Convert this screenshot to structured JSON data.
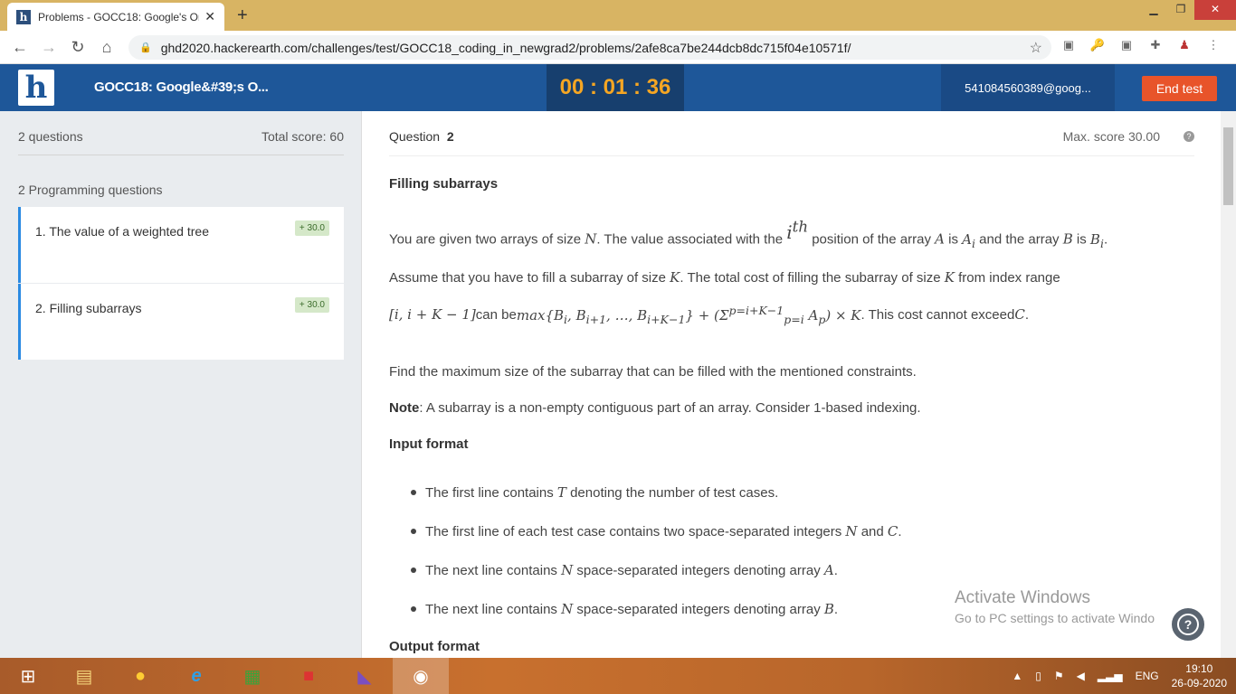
{
  "browser": {
    "tab_title": "Problems - GOCC18: Google's Or",
    "favicon_letter": "h",
    "url": "ghd2020.hackerearth.com/challenges/test/GOCC18_coding_in_newgrad2/problems/2afe8ca7be244dcb8dc715f04e10571f/"
  },
  "header": {
    "logo_letter": "h",
    "test_title": "GOCC18: Google&#39;s O...",
    "timer": "00 : 01 : 36",
    "user": "541084560389@goog...",
    "end_test": "End test"
  },
  "sidebar": {
    "questions_count": "2 questions",
    "total_score": "Total score: 60",
    "category": "2 Programming questions",
    "items": [
      {
        "label": "1.  The value of a weighted tree",
        "badge": "+ 30.0"
      },
      {
        "label": "2.  Filling subarrays",
        "badge": "+ 30.0"
      }
    ]
  },
  "question": {
    "label": "Question",
    "number": "2",
    "max_score": "Max. score 30.00",
    "title": "Filling subarrays",
    "p1_a": "You are given two arrays of size ",
    "p1_b": ". The value associated with the ",
    "p1_c": " position of the array ",
    "p1_d": " is ",
    "p1_e": " and the array ",
    "p1_f": " is ",
    "p2": "Assume that you have to fill a subarray of size ",
    "p2_b": ". The total cost of filling the subarray of size ",
    "p2_c": " from index range",
    "p3_a": " can be ",
    "p3_b": ". This cost cannot exceed ",
    "p4": "Find the maximum size of the subarray that can be filled with the mentioned constraints.",
    "note_label": "Note",
    "note_text": ": A subarray is a non-empty contiguous part of an array. Consider 1-based indexing.",
    "input_format": "Input format",
    "bullets": [
      {
        "a": "The first line contains ",
        "var": "T",
        "b": " denoting the number of test cases."
      },
      {
        "a": "The first line of each test case contains two space-separated integers ",
        "var": "N",
        "mid": " and ",
        "var2": "C",
        "b": "."
      },
      {
        "a": "The next line contains ",
        "var": "N",
        "b": " space-separated integers denoting array ",
        "var2": "A",
        "c": "."
      },
      {
        "a": "The next line contains ",
        "var": "N",
        "b": " space-separated integers denoting array ",
        "var2": "B",
        "c": "."
      }
    ],
    "output_format": "Output format"
  },
  "watermark": {
    "line1": "Activate Windows",
    "line2": "Go to PC settings to activate Windo"
  },
  "taskbar": {
    "lang": "ENG",
    "time": "19:10",
    "date": "26-09-2020"
  }
}
